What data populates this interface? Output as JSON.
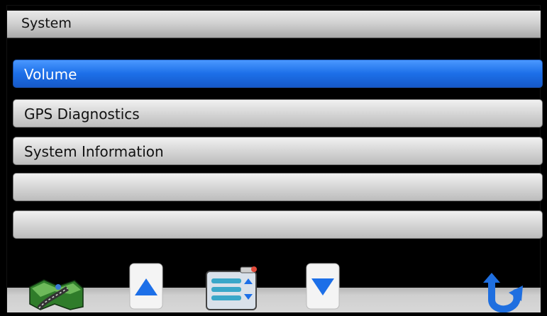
{
  "title": "System",
  "menu": {
    "items": [
      {
        "label": "Volume",
        "selected": true
      },
      {
        "label": "GPS Diagnostics",
        "selected": false
      },
      {
        "label": "System Information",
        "selected": false
      },
      {
        "label": "",
        "selected": false
      },
      {
        "label": "",
        "selected": false
      }
    ]
  },
  "toolbar": {
    "buttons": [
      "map-icon",
      "scroll-up-icon",
      "menu-list-icon",
      "scroll-down-icon",
      "back-icon"
    ]
  },
  "colors": {
    "selected": "#1c6fe8",
    "background": "#000000"
  }
}
